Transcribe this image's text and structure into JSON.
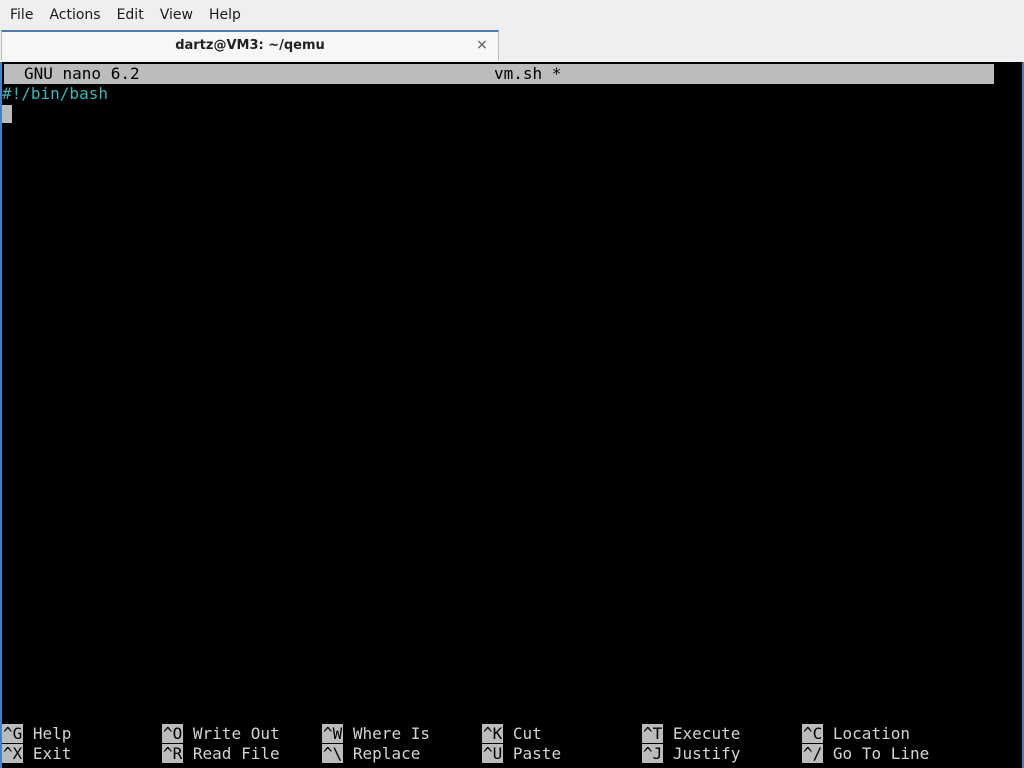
{
  "menu": {
    "items": [
      "File",
      "Actions",
      "Edit",
      "View",
      "Help"
    ]
  },
  "tab": {
    "title": "dartz@VM3: ~/qemu",
    "close_glyph": "×"
  },
  "nano": {
    "version": "GNU nano 6.2",
    "filename": "vm.sh *",
    "lines": [
      "#!/bin/bash"
    ]
  },
  "shortcuts": {
    "row1": [
      {
        "key": "^G",
        "label": "Help"
      },
      {
        "key": "^O",
        "label": "Write Out"
      },
      {
        "key": "^W",
        "label": "Where Is"
      },
      {
        "key": "^K",
        "label": "Cut"
      },
      {
        "key": "^T",
        "label": "Execute"
      },
      {
        "key": "^C",
        "label": "Location"
      }
    ],
    "row2": [
      {
        "key": "^X",
        "label": "Exit"
      },
      {
        "key": "^R",
        "label": "Read File"
      },
      {
        "key": "^\\",
        "label": "Replace"
      },
      {
        "key": "^U",
        "label": "Paste"
      },
      {
        "key": "^J",
        "label": "Justify"
      },
      {
        "key": "^/",
        "label": "Go To Line"
      }
    ]
  },
  "colors": {
    "accent": "#3d7fc2",
    "comment": "#3fb3b5",
    "titlebar_bg": "#bcbcbc",
    "terminal_bg": "#000000"
  }
}
